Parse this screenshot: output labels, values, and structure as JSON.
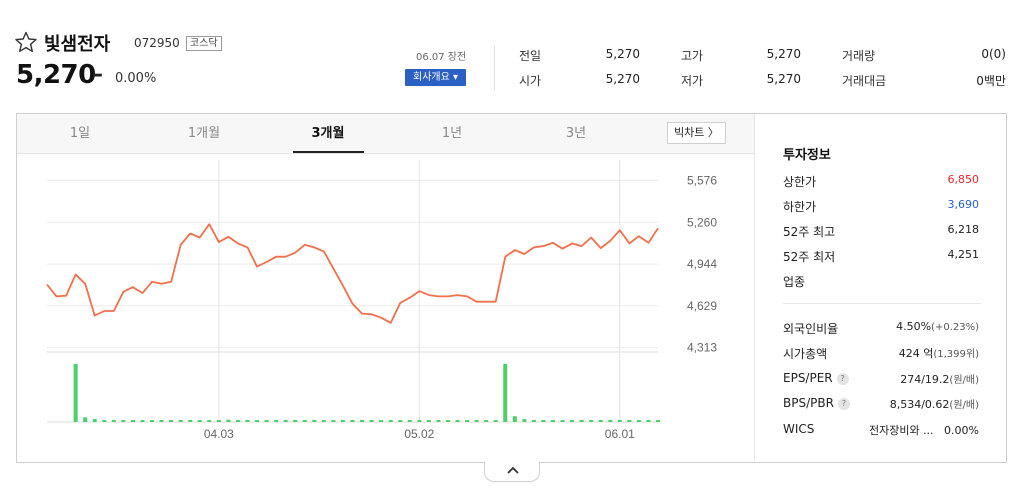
{
  "stock": {
    "name": "빛샘전자",
    "code": "072950",
    "market": "코스닥",
    "price": "5,270",
    "change_symbol": "–",
    "change_rate": "0.00%",
    "date_label": "06.07 장전",
    "company_button": "회사개요 ▾"
  },
  "quote": {
    "items": [
      {
        "label": "전일",
        "value": "5,270"
      },
      {
        "label": "고가",
        "value": "5,270"
      },
      {
        "label": "거래량",
        "value": "0(0)"
      },
      {
        "label": "시가",
        "value": "5,270"
      },
      {
        "label": "저가",
        "value": "5,270"
      },
      {
        "label": "거래대금",
        "value": "0백만"
      }
    ]
  },
  "tabs": {
    "items": [
      "1일",
      "1개월",
      "3개월",
      "1년",
      "3년"
    ],
    "active_index": 2,
    "bigchart_label": "빅차트 〉"
  },
  "colors": {
    "up": "#e8262c",
    "down": "#2a5fc4",
    "line": "#f0704a",
    "volume": "#4cd06a",
    "button": "#2a5fc4"
  },
  "chart_data": {
    "type": "line",
    "y_ticks": [
      5576,
      5260,
      4944,
      4629,
      4313
    ],
    "y_tick_labels": [
      "5,576",
      "5,260",
      "4,944",
      "4,629",
      "4,313"
    ],
    "ylim": [
      4280,
      5700
    ],
    "x_tick_labels": [
      "04.03",
      "05.02",
      "06.01"
    ],
    "x_tick_indices": [
      18,
      39,
      60
    ],
    "grid": true,
    "series": [
      {
        "values": [
          4790,
          4700,
          4705,
          4865,
          4795,
          4555,
          4590,
          4590,
          4735,
          4770,
          4725,
          4810,
          4795,
          4810,
          5090,
          5175,
          5145,
          5245,
          5110,
          5150,
          5100,
          5070,
          4925,
          4960,
          5000,
          5000,
          5030,
          5090,
          5070,
          5040,
          4910,
          4780,
          4645,
          4570,
          4565,
          4540,
          4500,
          4650,
          4690,
          4740,
          4710,
          4700,
          4700,
          4710,
          4700,
          4660,
          4660,
          4660,
          5000,
          5050,
          5020,
          5070,
          5080,
          5105,
          5060,
          5100,
          5080,
          5145,
          5065,
          5120,
          5200,
          5100,
          5155,
          5105,
          5215
        ]
      }
    ],
    "volume_values": [
      0,
      0,
      0,
      100,
      8,
      5,
      2,
      2,
      2,
      2,
      2,
      2,
      2,
      2,
      2,
      2,
      2,
      2,
      2,
      4,
      2,
      2,
      2,
      2,
      2,
      2,
      2,
      2,
      2,
      2,
      2,
      2,
      2,
      2,
      2,
      2,
      2,
      2,
      2,
      2,
      2,
      2,
      2,
      2,
      2,
      2,
      2,
      2,
      100,
      10,
      5,
      3,
      2,
      2,
      2,
      2,
      2,
      2,
      2,
      2,
      2,
      2,
      2,
      2,
      2
    ]
  },
  "info": {
    "title": "투자정보",
    "rows_top": [
      {
        "label": "상한가",
        "value": "6,850",
        "tone": "up"
      },
      {
        "label": "하한가",
        "value": "3,690",
        "tone": "down"
      },
      {
        "label": "52주 최고",
        "value": "6,218",
        "tone": ""
      },
      {
        "label": "52주 최저",
        "value": "4,251",
        "tone": ""
      },
      {
        "label": "업종",
        "value": "",
        "tone": ""
      }
    ],
    "rows_bottom": [
      {
        "label": "외국인비율",
        "value": "4.50%",
        "sub": "(+0.23%)",
        "help": false
      },
      {
        "label": "시가총액",
        "value": "424 억",
        "sub": "(1,399위)",
        "help": false
      },
      {
        "label": "EPS/PER",
        "value": "274/19.2",
        "sub": "(원/배)",
        "help": true
      },
      {
        "label": "BPS/PBR",
        "value": "8,534/0.62",
        "sub": "(원/배)",
        "help": true
      },
      {
        "label": "WICS",
        "value": "전자장비와 ...   0.00%",
        "sub": "",
        "help": false
      }
    ]
  },
  "collapse_label": "^"
}
